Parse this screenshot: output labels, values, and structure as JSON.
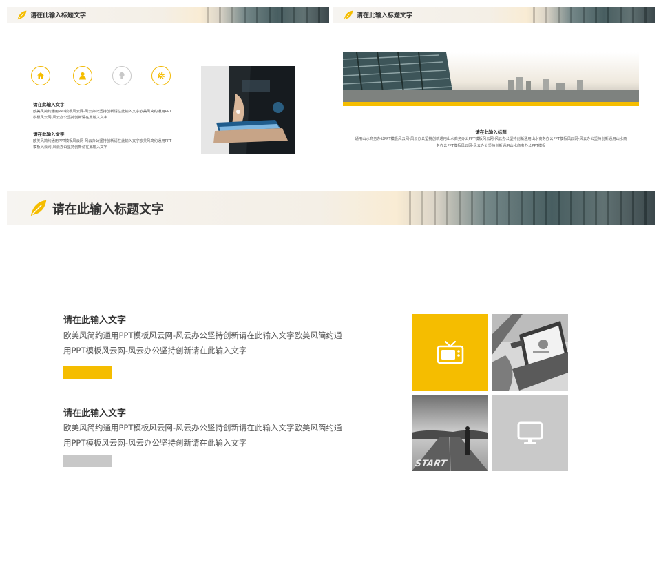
{
  "colors": {
    "accent": "#f5bd00",
    "grey_bar": "#c8c8c8",
    "tile_grey": "#c9c9c9",
    "text": "#333333"
  },
  "slide1": {
    "header_title": "请在此输入标题文字",
    "icons": [
      "home-icon",
      "user-icon",
      "lightbulb-icon",
      "gear-icon"
    ],
    "blocks": [
      {
        "heading": "请在此输入文字",
        "body": "欧美风简约通用PPT模板风云网-风云办公坚持创新请在此输入文字欧美风简约通用PPT模板风云网-风云办公坚持创新请在此输入文字"
      },
      {
        "heading": "请在此输入文字",
        "body": "欧美风简约通用PPT模板风云网-风云办公坚持创新请在此输入文字欧美风简约通用PPT模板风云网-风云办公坚持创新请在此输入文字"
      }
    ]
  },
  "slide2": {
    "header_title": "请在此输入标题文字",
    "heading": "请在此输入标题",
    "body": "通用山水商务办公PPT模板风云网-风云办公坚持创新通用山水商务办公PPT模板风云网-风云办公坚持创新通用山水商务办公PPT模板风云网-风云办公坚持创新通用山水商务办公PPT模板风云网-风云办公坚持创新通用山水商务办公PPT模板"
  },
  "slide3": {
    "header_title": "请在此输入标题文字",
    "blocks": [
      {
        "heading": "请在此输入文字",
        "body": "欧美风简约通用PPT模板风云网-风云办公坚持创新请在此输入文字欧美风简约通用PPT模板风云网-风云办公坚持创新请在此输入文字",
        "bar_color": "#f5bd00"
      },
      {
        "heading": "请在此输入文字",
        "body": "欧美风简约通用PPT模板风云网-风云办公坚持创新请在此输入文字欧美风简约通用PPT模板风云网-风云办公坚持创新请在此输入文字",
        "bar_color": "#c8c8c8"
      }
    ],
    "tiles": {
      "tv_icon": "tv-icon",
      "monitor_icon": "monitor-icon",
      "road_text": "START"
    }
  }
}
